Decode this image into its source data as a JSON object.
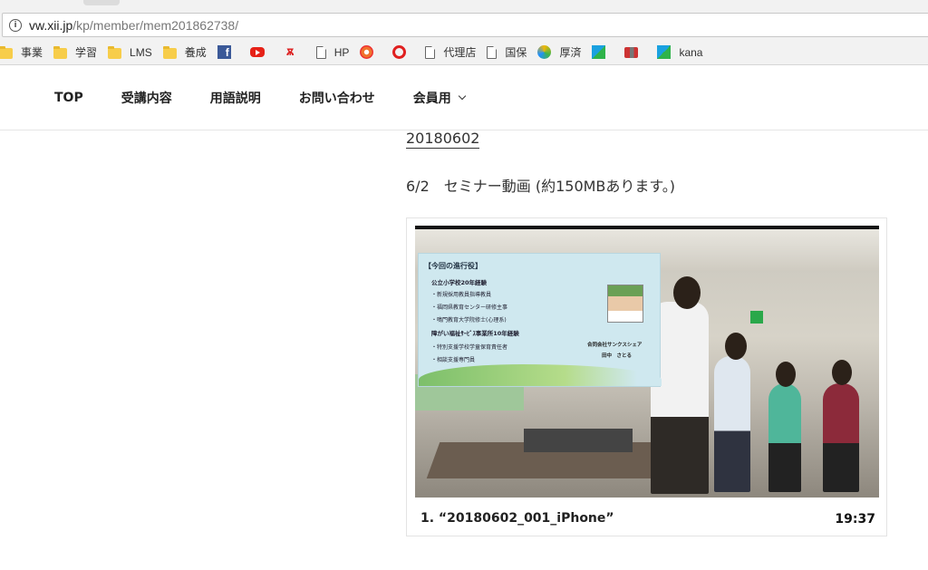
{
  "browser": {
    "url_host": "vw.xii.jp",
    "url_path": "/kp/member/mem201862738/",
    "bookmarks": [
      {
        "icon": "folder-icon",
        "label": "事業"
      },
      {
        "icon": "folder-icon",
        "label": "学習"
      },
      {
        "icon": "folder-icon",
        "label": "LMS"
      },
      {
        "icon": "folder-icon",
        "label": "養成"
      },
      {
        "icon": "facebook-icon",
        "label": ""
      },
      {
        "icon": "youtube-icon",
        "label": ""
      },
      {
        "icon": "red-symbol-icon",
        "label": ""
      },
      {
        "icon": "page-icon",
        "label": "HP"
      },
      {
        "icon": "orange-swirl-icon",
        "label": ""
      },
      {
        "icon": "red-link-icon",
        "label": ""
      },
      {
        "icon": "page-icon",
        "label": "代理店"
      },
      {
        "icon": "page-icon",
        "label": "国保"
      },
      {
        "icon": "colorwheel-icon",
        "label": "厚済"
      },
      {
        "icon": "triangle-icon",
        "label": ""
      },
      {
        "icon": "cards-icon",
        "label": ""
      },
      {
        "icon": "triangle-icon",
        "label": "kana"
      }
    ]
  },
  "nav": {
    "items": [
      "TOP",
      "受講内容",
      "用語説明",
      "お問い合わせ",
      "会員用"
    ]
  },
  "post": {
    "title": "20180602",
    "description": "6/2　セミナー動画 (約150MBあります。)"
  },
  "video": {
    "caption": "1. “20180602_001_iPhone”",
    "duration": "19:37",
    "slide": {
      "heading": "【今回の進行役】",
      "lines": [
        "公立小学校20年経験",
        "・新規採用教員指導教員",
        "・福岡県教育センター研修主事",
        "・鳴門教育大学院修士(心理系)",
        "障がい福祉ｻｰﾋﾞｽ事業所10年経験",
        "・特別支援学校学童保育責任者",
        "・相談支援専門員"
      ],
      "company": "合同会社サンクスシェア",
      "name": "田中　さとる"
    }
  }
}
